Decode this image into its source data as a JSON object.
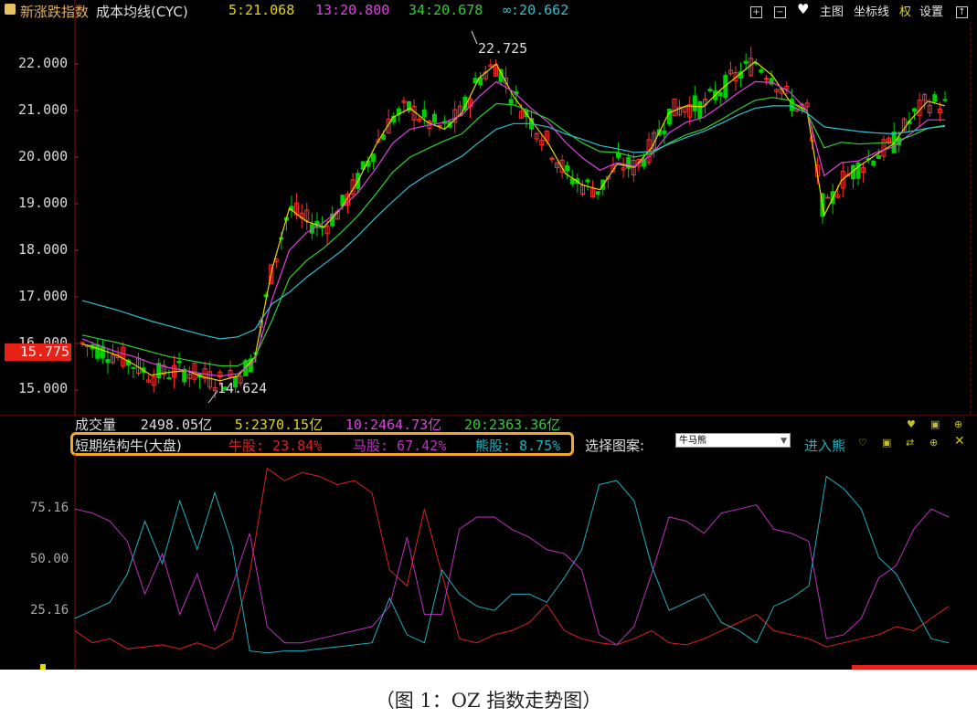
{
  "header": {
    "index_name": "新涨跌指数",
    "indicator": "成本均线(CYC)",
    "ma5": "5:21.068",
    "ma13": "13:20.800",
    "ma34": "34:20.678",
    "ma_inf": "∞:20.662"
  },
  "toolbar": {
    "main_chart": "主图",
    "axis_line": "坐标线",
    "rights": "权",
    "settings": "设置"
  },
  "main_chart": {
    "y_ticks": [
      "22.000",
      "21.000",
      "20.000",
      "19.000",
      "18.000",
      "17.000",
      "16.000",
      "15.000"
    ],
    "current_price": "15.775",
    "high_label": "22.725",
    "low_label": "14.624"
  },
  "volume": {
    "label": "成交量",
    "value": "2498.05亿",
    "ma5": "5:2370.15亿",
    "ma10": "10:2464.73亿",
    "ma20": "20:2363.36亿"
  },
  "oscillator": {
    "title": "短期结构牛(大盘)",
    "bull": "牛股: 23.84%",
    "horse": "马股: 67.42%",
    "bear": "熊股: 8.75%",
    "select_label": "选择图案:",
    "select_value": "牛马熊",
    "enter": "进入熊",
    "y_ticks": [
      "75.16",
      "50.00",
      "25.16"
    ]
  },
  "caption": "（图 1：OZ 指数走势图）",
  "colors": {
    "up": "#ff3030",
    "down": "#00d000",
    "ma5": "#e6d700",
    "ma13": "#e040e0",
    "ma34": "#30d030",
    "ma_inf": "#30c0d0",
    "bull": "#e02020",
    "horse": "#c030c0",
    "bear": "#20b0c0"
  },
  "chart_data": {
    "type": "line",
    "series": [
      {
        "name": "5",
        "values": [
          15.99,
          15.88,
          15.75,
          15.55,
          15.32,
          15.38,
          15.42,
          15.28,
          15.2,
          15.3,
          15.7,
          17.6,
          18.9,
          18.62,
          18.5,
          18.9,
          19.5,
          20.25,
          20.85,
          21.05,
          20.75,
          20.6,
          20.95,
          21.7,
          22.0,
          21.3,
          20.8,
          20.3,
          19.65,
          19.4,
          19.3,
          19.85,
          19.78,
          20.2,
          20.95,
          21.1,
          21.08,
          21.45,
          21.75,
          22.05,
          21.75,
          21.2,
          21.0,
          18.75,
          19.5,
          19.8,
          20.05,
          20.28,
          20.8,
          21.2,
          21.1
        ]
      },
      {
        "name": "13",
        "values": [
          16.1,
          15.95,
          15.82,
          15.72,
          15.58,
          15.48,
          15.42,
          15.35,
          15.3,
          15.35,
          15.62,
          16.95,
          18.0,
          18.38,
          18.6,
          18.9,
          19.25,
          19.75,
          20.3,
          20.6,
          20.68,
          20.75,
          20.9,
          21.3,
          21.62,
          21.4,
          21.05,
          20.75,
          20.32,
          19.98,
          19.72,
          19.88,
          19.8,
          20.05,
          20.52,
          20.75,
          20.85,
          21.1,
          21.38,
          21.62,
          21.6,
          21.4,
          21.0,
          19.6,
          19.88,
          19.92,
          20.1,
          20.22,
          20.5,
          20.8,
          20.8
        ]
      },
      {
        "name": "34",
        "values": [
          16.18,
          16.1,
          16.02,
          15.92,
          15.82,
          15.72,
          15.65,
          15.58,
          15.52,
          15.52,
          15.7,
          16.5,
          17.4,
          17.78,
          18.05,
          18.38,
          18.75,
          19.2,
          19.68,
          20.0,
          20.18,
          20.35,
          20.5,
          20.85,
          21.15,
          21.12,
          20.98,
          20.82,
          20.55,
          20.3,
          20.12,
          20.1,
          20.0,
          20.08,
          20.3,
          20.48,
          20.6,
          20.8,
          21.02,
          21.22,
          21.28,
          21.22,
          20.95,
          20.2,
          20.32,
          20.28,
          20.3,
          20.32,
          20.45,
          20.62,
          20.68
        ]
      },
      {
        "name": "∞",
        "values": [
          16.92,
          16.82,
          16.72,
          16.6,
          16.48,
          16.38,
          16.28,
          16.18,
          16.1,
          16.14,
          16.3,
          16.85,
          17.1,
          17.42,
          17.7,
          17.98,
          18.32,
          18.7,
          19.05,
          19.38,
          19.62,
          19.82,
          20.02,
          20.32,
          20.6,
          20.72,
          20.72,
          20.65,
          20.5,
          20.38,
          20.25,
          20.18,
          20.1,
          20.12,
          20.28,
          20.42,
          20.55,
          20.72,
          20.9,
          21.05,
          21.1,
          21.1,
          20.95,
          20.65,
          20.6,
          20.55,
          20.52,
          20.5,
          20.55,
          20.62,
          20.66
        ]
      }
    ],
    "ylim": [
      14.5,
      23.0
    ],
    "highlights": {
      "high": 22.725,
      "low": 14.624
    },
    "oscillator_series": [
      {
        "name": "牛股",
        "values": [
          12,
          6,
          8,
          3,
          4,
          5,
          3,
          6,
          3,
          8,
          40,
          92,
          86,
          90,
          88,
          84,
          86,
          80,
          42,
          34,
          72,
          40,
          8,
          6,
          10,
          12,
          16,
          25,
          12,
          8,
          6,
          5,
          8,
          12,
          6,
          5,
          8,
          12,
          16,
          20,
          12,
          10,
          8,
          4,
          6,
          8,
          10,
          14,
          12,
          18,
          24
        ]
      },
      {
        "name": "马股",
        "values": [
          72,
          70,
          66,
          56,
          30,
          50,
          20,
          40,
          12,
          34,
          60,
          14,
          6,
          6,
          8,
          10,
          12,
          14,
          24,
          58,
          20,
          20,
          62,
          68,
          68,
          62,
          58,
          52,
          50,
          42,
          10,
          5,
          14,
          40,
          68,
          66,
          60,
          70,
          72,
          74,
          62,
          60,
          56,
          8,
          10,
          18,
          38,
          44,
          62,
          72,
          68
        ]
      },
      {
        "name": "熊股",
        "values": [
          18,
          22,
          26,
          40,
          66,
          45,
          76,
          52,
          80,
          54,
          2,
          1,
          2,
          2,
          3,
          4,
          5,
          6,
          28,
          10,
          6,
          42,
          30,
          24,
          22,
          30,
          30,
          26,
          38,
          52,
          84,
          86,
          76,
          44,
          22,
          26,
          30,
          16,
          12,
          6,
          24,
          28,
          34,
          88,
          82,
          72,
          48,
          40,
          24,
          8,
          6
        ]
      }
    ],
    "osc_ylim": [
      0,
      100
    ]
  }
}
